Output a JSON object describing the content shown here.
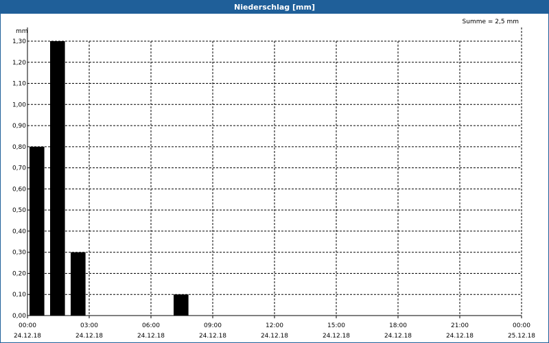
{
  "window": {
    "title": "Niederschlag [mm]"
  },
  "chart_data": {
    "type": "bar",
    "title": "Niederschlag [mm]",
    "ylabel": "mm",
    "annotation": "Summe = 2,5 mm",
    "ylim": [
      0,
      1.3
    ],
    "yticks": [
      "0,00",
      "0,10",
      "0,20",
      "0,30",
      "0,40",
      "0,50",
      "0,60",
      "0,70",
      "0,80",
      "0,90",
      "1,00",
      "1,10",
      "1,20",
      "1,30"
    ],
    "xlim_hours": [
      0,
      24
    ],
    "xticks": [
      {
        "time": "00:00",
        "date": "24.12.18"
      },
      {
        "time": "03:00",
        "date": "24.12.18"
      },
      {
        "time": "06:00",
        "date": "24.12.18"
      },
      {
        "time": "09:00",
        "date": "24.12.18"
      },
      {
        "time": "12:00",
        "date": "24.12.18"
      },
      {
        "time": "15:00",
        "date": "24.12.18"
      },
      {
        "time": "18:00",
        "date": "24.12.18"
      },
      {
        "time": "21:00",
        "date": "24.12.18"
      },
      {
        "time": "00:00",
        "date": "25.12.18"
      }
    ],
    "series": [
      {
        "values": [
          {
            "hour": 0,
            "value": 0.8
          },
          {
            "hour": 1,
            "value": 1.3
          },
          {
            "hour": 2,
            "value": 0.3
          },
          {
            "hour": 7,
            "value": 0.1
          }
        ]
      }
    ],
    "bar_color": "#000000",
    "grid": true
  }
}
